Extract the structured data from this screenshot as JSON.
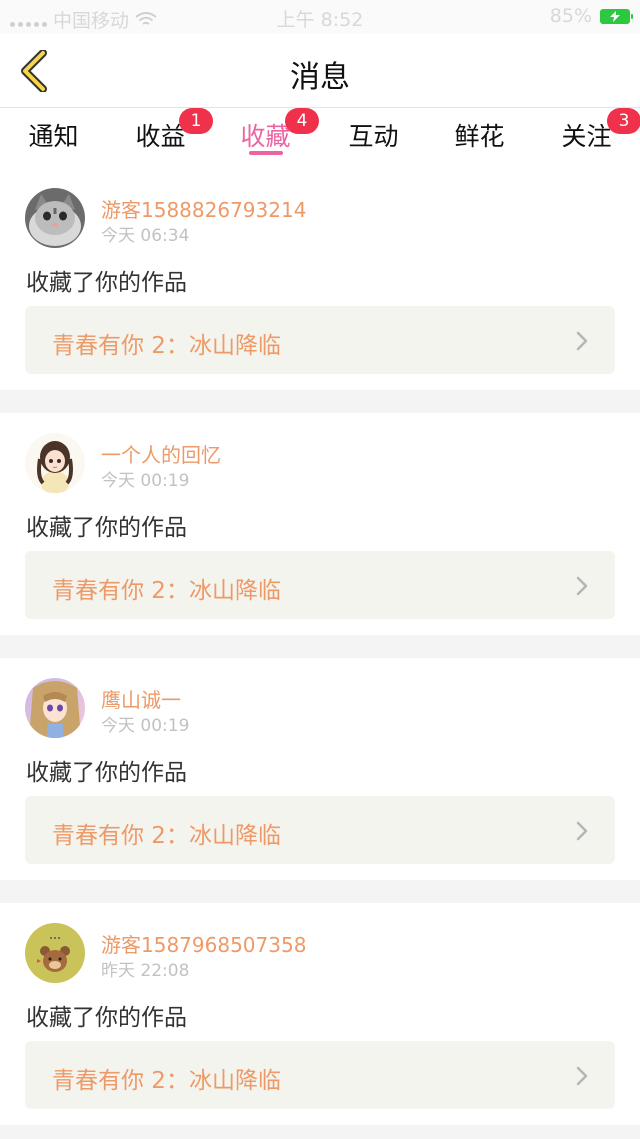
{
  "status_bar": {
    "carrier": "中国移动",
    "time": "上午 8:52",
    "battery": "85%"
  },
  "header": {
    "title": "消息",
    "back_icon": "chevron-left-icon",
    "accent_color": "#f7d54a"
  },
  "tabs": [
    {
      "label": "通知",
      "badge": "",
      "active": false
    },
    {
      "label": "收益",
      "badge": "1",
      "active": false
    },
    {
      "label": "收藏",
      "badge": "4",
      "active": true
    },
    {
      "label": "互动",
      "badge": "",
      "active": false
    },
    {
      "label": "鲜花",
      "badge": "",
      "active": false
    },
    {
      "label": "关注",
      "badge": "3",
      "active": false
    }
  ],
  "colors": {
    "active_tab": "#ec64a0",
    "badge": "#f0314c",
    "username": "#ee9a68",
    "work_box": "#f4f4ee"
  },
  "messages": [
    {
      "username": "游客1588826793214",
      "time": "今天 06:34",
      "action": "收藏了你的作品",
      "work_title": "青春有你 2：冰山降临",
      "avatar": "cat-avatar"
    },
    {
      "username": "一个人的回忆",
      "time": "今天 00:19",
      "action": "收藏了你的作品",
      "work_title": "青春有你 2：冰山降临",
      "avatar": "anime-girl-avatar"
    },
    {
      "username": "鹰山诚一",
      "time": "今天 00:19",
      "action": "收藏了你的作品",
      "work_title": "青春有你 2：冰山降临",
      "avatar": "anime-portrait-avatar"
    },
    {
      "username": "游客1587968507358",
      "time": "昨天 22:08",
      "action": "收藏了你的作品",
      "work_title": "青春有你 2：冰山降临",
      "avatar": "bear-avatar"
    }
  ]
}
